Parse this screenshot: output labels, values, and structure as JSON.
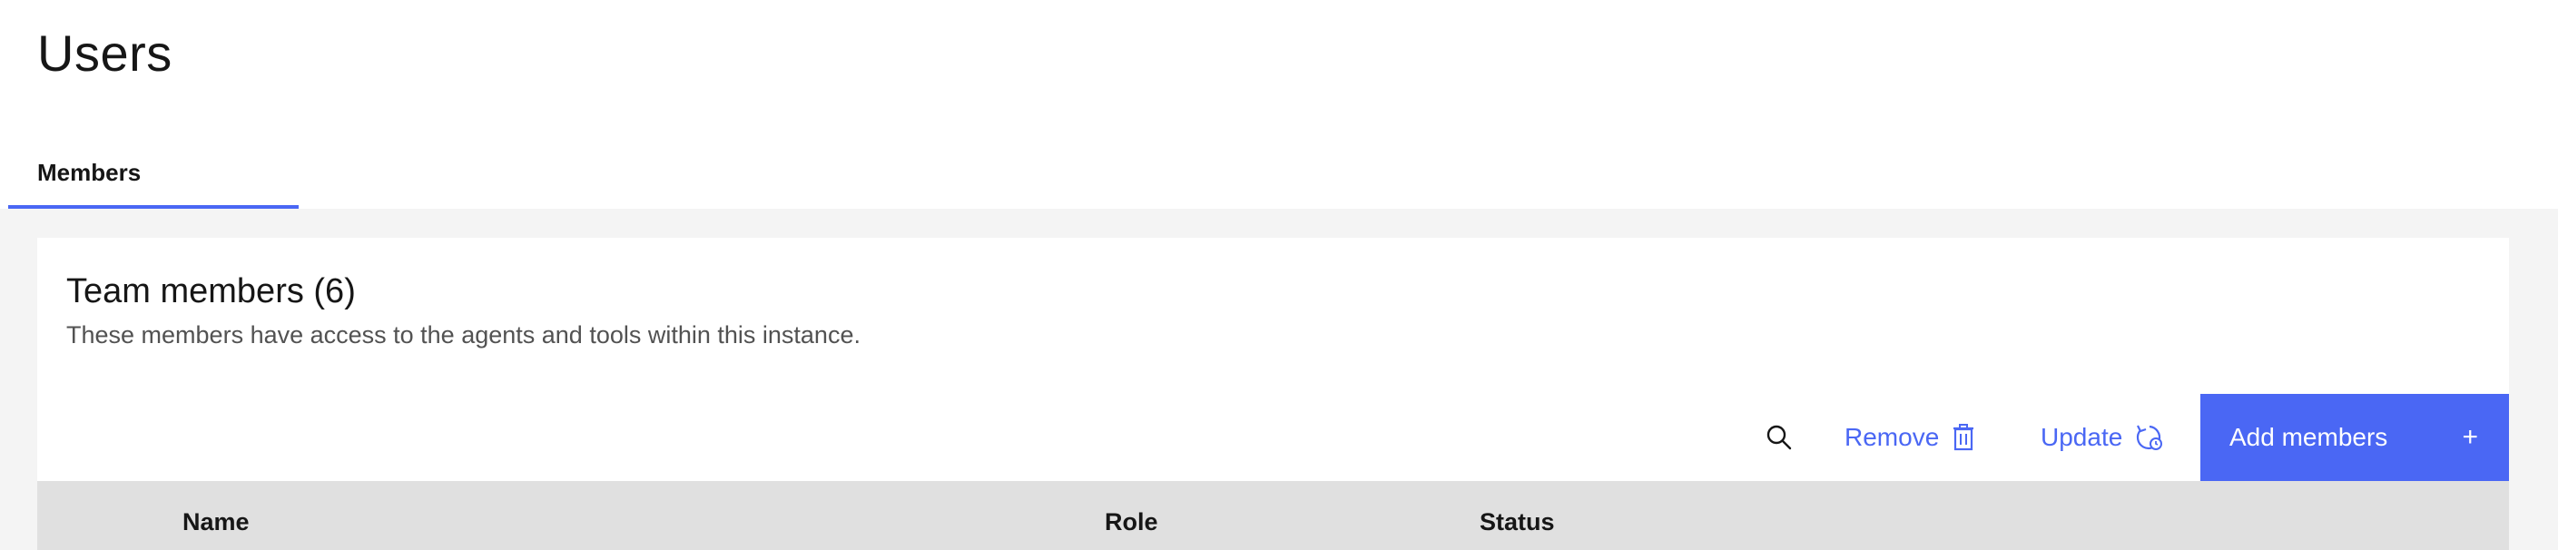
{
  "page": {
    "title": "Users"
  },
  "tabs": [
    {
      "label": "Members",
      "selected": true
    }
  ],
  "card": {
    "title": "Team members (6)",
    "description": "These members have access to the agents and tools within this instance."
  },
  "toolbar": {
    "search_icon": "search-icon",
    "remove_label": "Remove",
    "remove_icon": "trash-icon",
    "update_label": "Update",
    "update_icon": "refresh-icon",
    "add_label": "Add members",
    "add_icon": "+"
  },
  "table": {
    "columns": [
      "Name",
      "Role",
      "Status"
    ],
    "rows": []
  },
  "colors": {
    "accent": "#4a67f4",
    "page_background": "#f4f4f4",
    "table_header": "#e0e0e0"
  }
}
